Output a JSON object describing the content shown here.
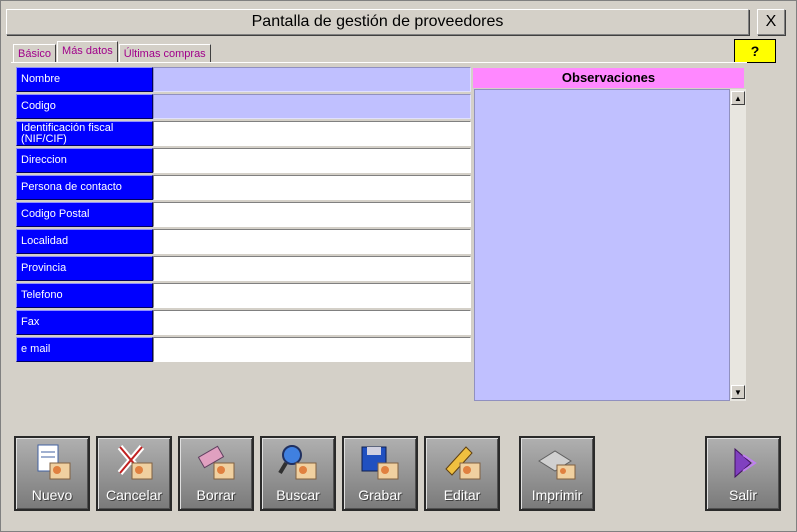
{
  "window": {
    "title": "Pantalla de gestión de proveedores",
    "close_label": "X",
    "help_label": "?"
  },
  "tabs": [
    {
      "label": "Básico",
      "active": false
    },
    {
      "label": "Más datos",
      "active": true
    },
    {
      "label": "Últimas compras",
      "active": false
    }
  ],
  "fields": [
    {
      "label": "Nombre",
      "value": ""
    },
    {
      "label": "Codigo",
      "value": ""
    },
    {
      "label": "Identificación fiscal (NIF/CIF)",
      "value": ""
    },
    {
      "label": "Direccion",
      "value": ""
    },
    {
      "label": "Persona de contacto",
      "value": ""
    },
    {
      "label": "Codigo Postal",
      "value": ""
    },
    {
      "label": "Localidad",
      "value": ""
    },
    {
      "label": "Provincia",
      "value": ""
    },
    {
      "label": "Telefono",
      "value": ""
    },
    {
      "label": "Fax",
      "value": ""
    },
    {
      "label": "e mail",
      "value": ""
    }
  ],
  "observaciones": {
    "title": "Observaciones",
    "value": ""
  },
  "toolbar": {
    "nuevo": "Nuevo",
    "cancelar": "Cancelar",
    "borrar": "Borrar",
    "buscar": "Buscar",
    "grabar": "Grabar",
    "editar": "Editar",
    "imprimir": "Imprimir",
    "salir": "Salir"
  },
  "colors": {
    "label_bg": "#0000ff",
    "lavender": "#c0c0ff",
    "obs_header": "#ff88ff",
    "help_bg": "#ffff00",
    "tab_text": "#a0008a"
  }
}
